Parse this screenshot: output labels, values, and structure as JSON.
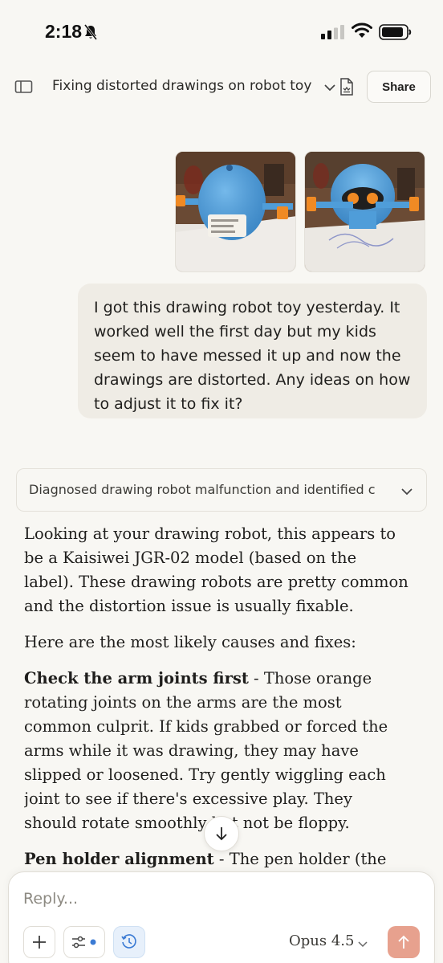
{
  "status_bar": {
    "time": "2:18"
  },
  "header": {
    "title": "Fixing distorted drawings on robot toy",
    "share_label": "Share"
  },
  "attachments": [
    {
      "alt": "Blue robot toy back view"
    },
    {
      "alt": "Blue robot toy front view"
    }
  ],
  "user_message": {
    "text": "I got this drawing robot toy yesterday. It worked well the first day but my kids seem to have messed it up and now the drawings are distorted. Any ideas on how to adjust it to fix it?"
  },
  "thinking": {
    "summary": "Diagnosed drawing robot malfunction and identified c"
  },
  "response": {
    "para1": "Looking at your drawing robot, this appears to be a Kaisiwei JGR-02 model (based on the label). These drawing robots are pretty common and the distortion issue is usually fixable.",
    "para2": "Here are the most likely causes and fixes:",
    "para3_bold": "Check the arm joints first",
    "para3_rest": " - Those orange rotating joints on the arms are the most common culprit. If kids grabbed or forced the arms while it was drawing, they may have slipped or loosened. Try gently wiggling each joint to see if there's excessive play. They should rotate smoothly but not be floppy.",
    "para4_bold": "Pen holder alignment",
    "para4_rest": " - The pen holder (the blue"
  },
  "composer": {
    "placeholder": "Reply...",
    "model": "Opus 4.5"
  },
  "colors": {
    "background": "#f8f7f3",
    "user_bubble": "#efece5",
    "send_button": "#e7a18e",
    "accent_blue": "#3b7bd4"
  }
}
